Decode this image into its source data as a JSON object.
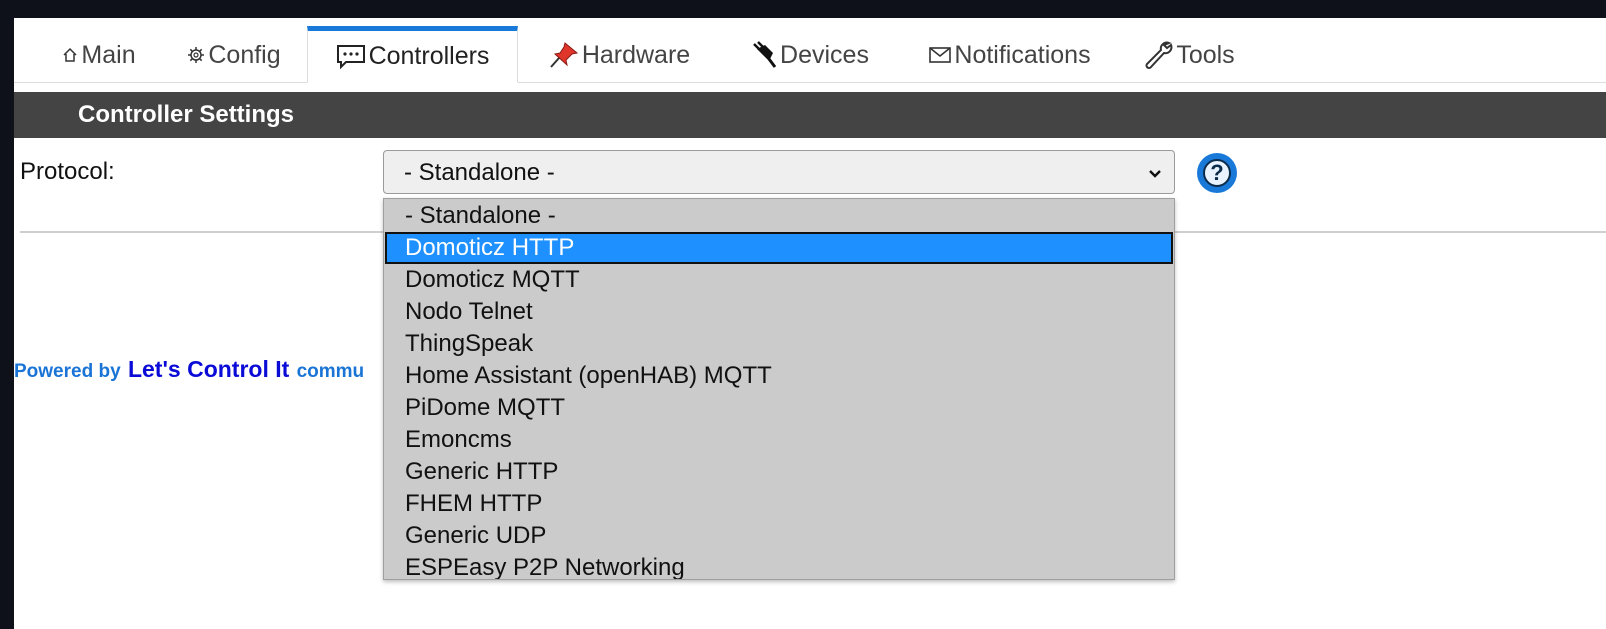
{
  "tabs": [
    {
      "label": "Main",
      "icon": "home-icon"
    },
    {
      "label": "Config",
      "icon": "gear-icon"
    },
    {
      "label": "Controllers",
      "icon": "chat-bubble-icon"
    },
    {
      "label": "Hardware",
      "icon": "pushpin-icon"
    },
    {
      "label": "Devices",
      "icon": "plug-icon"
    },
    {
      "label": "Notifications",
      "icon": "envelope-icon"
    },
    {
      "label": "Tools",
      "icon": "wrench-icon"
    }
  ],
  "active_tab": "Controllers",
  "section": {
    "title": "Controller Settings"
  },
  "form": {
    "protocol_label": "Protocol:",
    "protocol_value": "- Standalone -",
    "options": [
      "- Standalone -",
      "Domoticz HTTP",
      "Domoticz MQTT",
      "Nodo Telnet",
      "ThingSpeak",
      "Home Assistant (openHAB) MQTT",
      "PiDome MQTT",
      "Emoncms",
      "Generic HTTP",
      "FHEM HTTP",
      "Generic UDP",
      "ESPEasy P2P Networking"
    ],
    "highlighted_option": "Domoticz HTTP",
    "help_glyph": "?"
  },
  "footer": {
    "prefix": "Powered by",
    "link": "Let's Control It",
    "suffix": "commu"
  },
  "colors": {
    "accent": "#1879d8",
    "section_bar": "#444444",
    "highlight": "#1e90ff",
    "footer_text": "#1a74d6",
    "footer_link": "#0b0bd8"
  }
}
